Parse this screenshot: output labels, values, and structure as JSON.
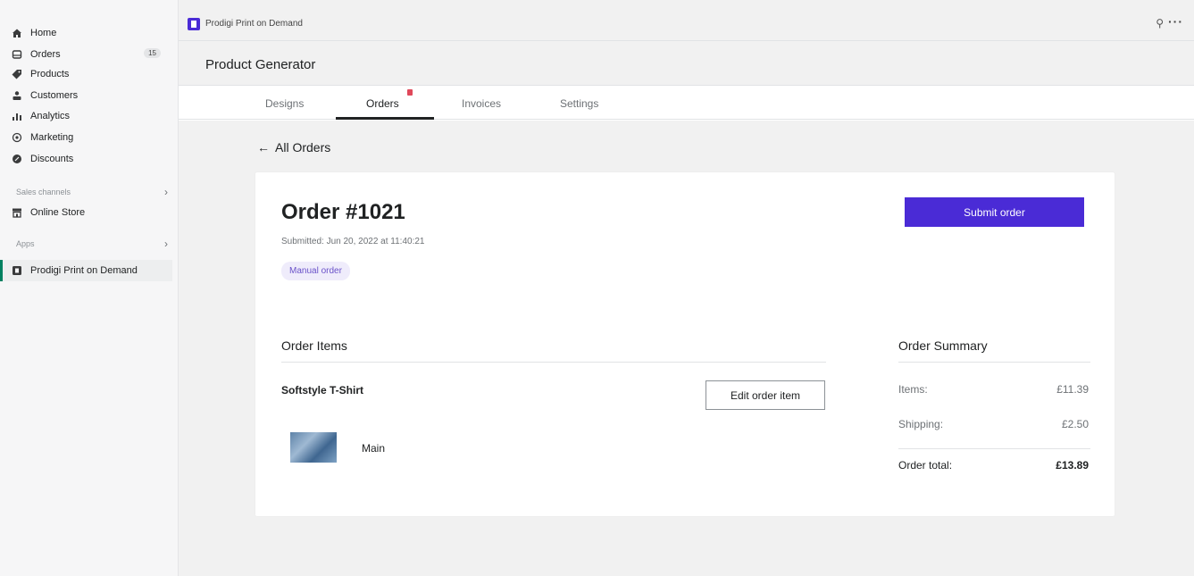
{
  "sidebar": {
    "items": [
      {
        "label": "Home",
        "icon": "home-icon"
      },
      {
        "label": "Orders",
        "icon": "orders-icon",
        "badge": "15"
      },
      {
        "label": "Products",
        "icon": "tag-icon"
      },
      {
        "label": "Customers",
        "icon": "person-icon"
      },
      {
        "label": "Analytics",
        "icon": "bar-chart-icon"
      },
      {
        "label": "Marketing",
        "icon": "target-icon"
      },
      {
        "label": "Discounts",
        "icon": "discount-icon"
      }
    ],
    "sales_channels_label": "Sales channels",
    "online_store_label": "Online Store",
    "apps_label": "Apps",
    "app_item_label": "Prodigi Print on Demand",
    "active_color": "#008060"
  },
  "topbar": {
    "app_name": "Prodigi Print on Demand",
    "pin_icon": "pin-icon",
    "more_icon": "more-horizontal-icon"
  },
  "page": {
    "title": "Product Generator"
  },
  "tabs": [
    {
      "label": "Designs",
      "active": false
    },
    {
      "label": "Orders",
      "active": true,
      "notification": true
    },
    {
      "label": "Invoices",
      "active": false
    },
    {
      "label": "Settings",
      "active": false
    }
  ],
  "main": {
    "back_link": "All Orders",
    "order": {
      "title": "Order #1021",
      "submitted": "Submitted: Jun 20, 2022 at 11:40:21",
      "type_badge": "Manual order",
      "submit_button": "Submit order"
    },
    "items_section": {
      "heading": "Order Items",
      "product_name": "Softstyle T-Shirt",
      "edit_button": "Edit order item",
      "image_label": "Main"
    },
    "summary": {
      "heading": "Order Summary",
      "items_label": "Items:",
      "items_value": "£11.39",
      "shipping_label": "Shipping:",
      "shipping_value": "£2.50",
      "total_label": "Order total:",
      "total_value": "£13.89"
    }
  },
  "colors": {
    "accent": "#4a2bd6",
    "badge_bg": "#efecfb",
    "badge_text": "#6a52c9",
    "notification": "#e0485a"
  }
}
